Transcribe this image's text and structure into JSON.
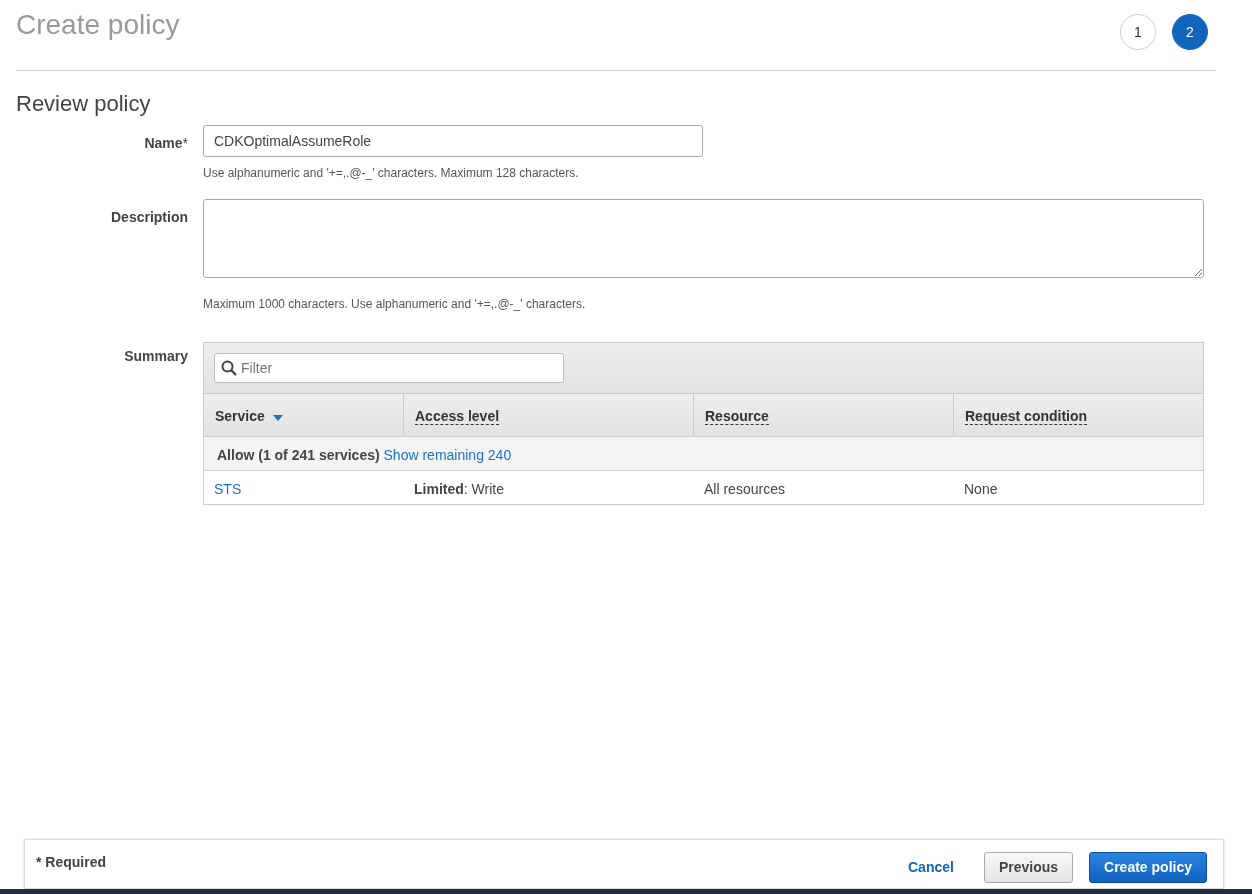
{
  "title": "Create policy",
  "steps": [
    {
      "label": "1",
      "selected": false
    },
    {
      "label": "2",
      "selected": true
    }
  ],
  "section_title": "Review policy",
  "name_field": {
    "label": "Name",
    "required_mark": "*",
    "value": "CDKOptimalAssumeRole",
    "hint": "Use alphanumeric and '+=,.@-_' characters. Maximum 128 characters."
  },
  "description_field": {
    "label": "Description",
    "hint": "Maximum 1000 characters. Use alphanumeric and '+=,.@-_' characters."
  },
  "summary": {
    "label": "Summary",
    "filter": {
      "placeholder": "Filter"
    },
    "columns": [
      {
        "label": "Service",
        "kind": "sort"
      },
      {
        "label": "Access level",
        "kind": "hint"
      },
      {
        "label": "Resource",
        "kind": "hint"
      },
      {
        "label": "Request condition",
        "kind": "hint"
      }
    ],
    "group": {
      "label": "Allow (1 of 241 services)",
      "link": "Show remaining 240"
    },
    "rows": [
      {
        "service": "STS",
        "access": "**Limited**: Write",
        "resource": "All resources",
        "condition": "None"
      }
    ]
  },
  "footer": {
    "note": "* Required",
    "buttons": [
      {
        "label": "Cancel",
        "kind": "link"
      },
      {
        "label": "Previous",
        "kind": "secondary"
      },
      {
        "label": "Create policy",
        "kind": "primary"
      }
    ]
  }
}
